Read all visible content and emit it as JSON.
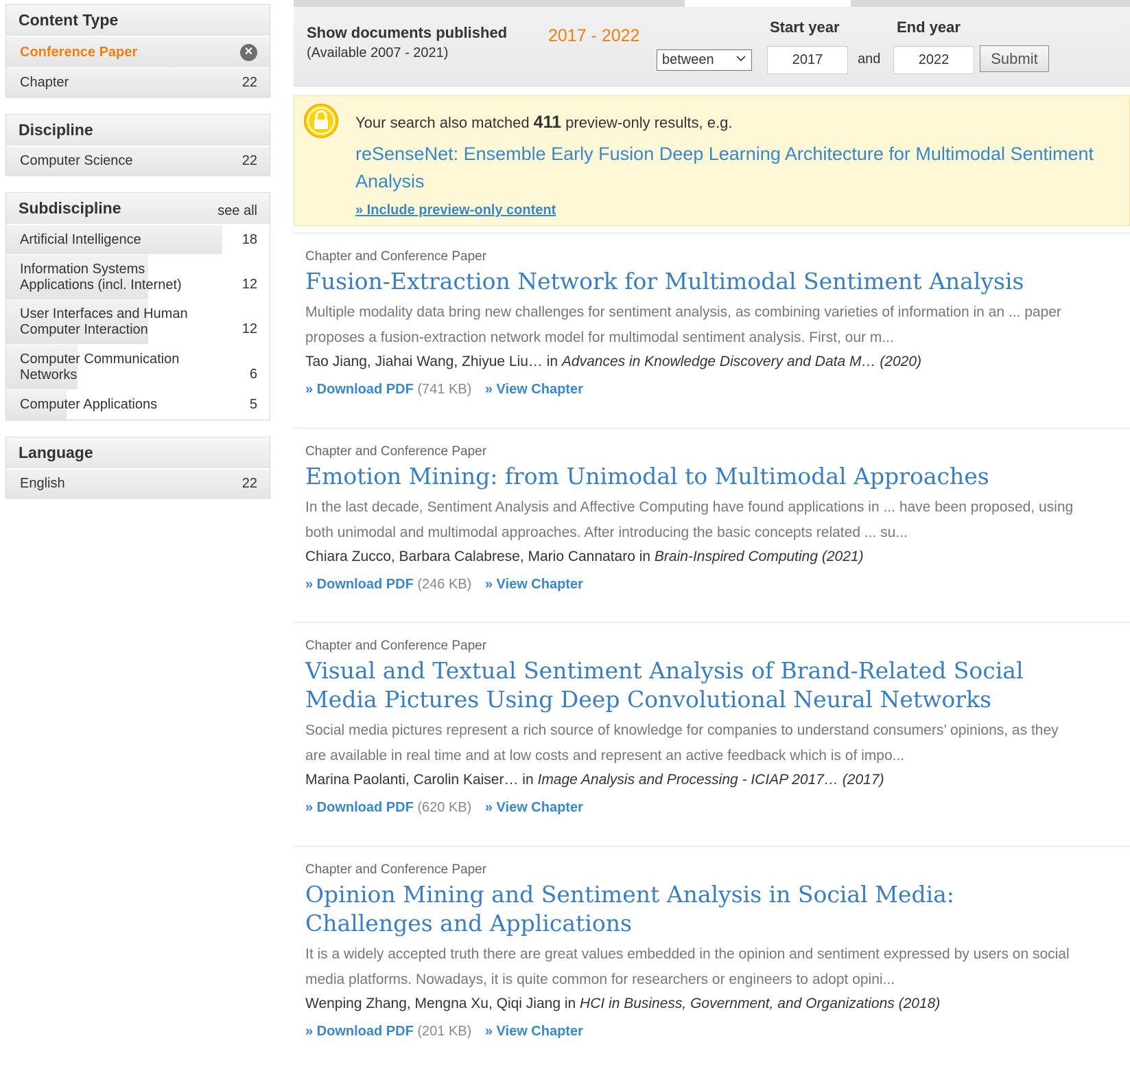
{
  "sidebar": {
    "content_type": {
      "title": "Content Type",
      "items": [
        {
          "label": "Conference Paper",
          "active": true
        },
        {
          "label": "Chapter",
          "count": "22"
        }
      ]
    },
    "discipline": {
      "title": "Discipline",
      "items": [
        {
          "label": "Computer Science",
          "count": "22"
        }
      ]
    },
    "subdiscipline": {
      "title": "Subdiscipline",
      "see_all": "see all",
      "items": [
        {
          "label": "Artificial Intelligence",
          "count": "18"
        },
        {
          "label": "Information Systems Applications (incl. Internet)",
          "count": "12"
        },
        {
          "label": "User Interfaces and Human Computer Interaction",
          "count": "12"
        },
        {
          "label": "Computer Communication Networks",
          "count": "6"
        },
        {
          "label": "Computer Applications",
          "count": "5"
        }
      ]
    },
    "language": {
      "title": "Language",
      "items": [
        {
          "label": "English",
          "count": "22"
        }
      ]
    }
  },
  "date_filter": {
    "label": "Show documents published",
    "available": "(Available 2007 - 2021)",
    "range": "2017 - 2022",
    "select_value": "between",
    "start_label": "Start year",
    "end_label": "End year",
    "start_value": "2017",
    "end_value": "2022",
    "and": "and",
    "submit": "Submit"
  },
  "preview": {
    "text_before": "Your search also matched ",
    "count": "411",
    "text_after": " preview-only results, e.g.",
    "link": "reSenseNet: Ensemble Early Fusion Deep Learning Architecture for Multimodal Sentiment Analysis",
    "include": "» Include preview-only content"
  },
  "results": [
    {
      "type": "Chapter and Conference Paper",
      "title": "Fusion-Extraction Network for Multimodal Sentiment Analysis",
      "snippet": "Multiple modality data bring new challenges for sentiment analysis, as combining varieties of information in an ... paper proposes a fusion-extraction network model for multimodal sentiment analysis. First, our m...",
      "authors": "Tao Jiang, Jiahai Wang, Zhiyue Liu…",
      "in": " in ",
      "source": "Advances in Knowledge Discovery and Data M… (2020)",
      "download": "» Download PDF",
      "size": "(741 KB)",
      "view": "» View Chapter"
    },
    {
      "type": "Chapter and Conference Paper",
      "title": "Emotion Mining: from Unimodal to Multimodal Approaches",
      "snippet": "In the last decade, Sentiment Analysis and Affective Computing have found applications in ... have been proposed, using both unimodal and multimodal approaches. After introducing the basic concepts related ... su...",
      "authors": "Chiara Zucco, Barbara Calabrese, Mario Cannataro",
      "in": " in ",
      "source": "Brain-Inspired Computing (2021)",
      "download": "» Download PDF",
      "size": "(246 KB)",
      "view": "» View Chapter"
    },
    {
      "type": "Chapter and Conference Paper",
      "title": "Visual and Textual Sentiment Analysis of Brand-Related Social Media Pictures Using Deep Convolutional Neural Networks",
      "snippet": "Social media pictures represent a rich source of knowledge for companies to understand consumers’ opinions, as they are available in real time and at low costs and represent an active feedback which is of impo...",
      "authors": "Marina Paolanti, Carolin Kaiser…",
      "in": " in ",
      "source": "Image Analysis and Processing - ICIAP 2017… (2017)",
      "download": "» Download PDF",
      "size": "(620 KB)",
      "view": "» View Chapter"
    },
    {
      "type": "Chapter and Conference Paper",
      "title": "Opinion Mining and Sentiment Analysis in Social Media: Challenges and Applications",
      "snippet": "It is a widely accepted truth there are great values embedded in the opinion and sentiment expressed by users on social media platforms. Nowadays, it is quite common for researchers or engineers to adopt opini...",
      "authors": "Wenping Zhang, Mengna Xu, Qiqi Jiang",
      "in": " in ",
      "source": "HCI in Business, Government, and Organizations (2018)",
      "download": "» Download PDF",
      "size": "(201 KB)",
      "view": "» View Chapter"
    }
  ]
}
